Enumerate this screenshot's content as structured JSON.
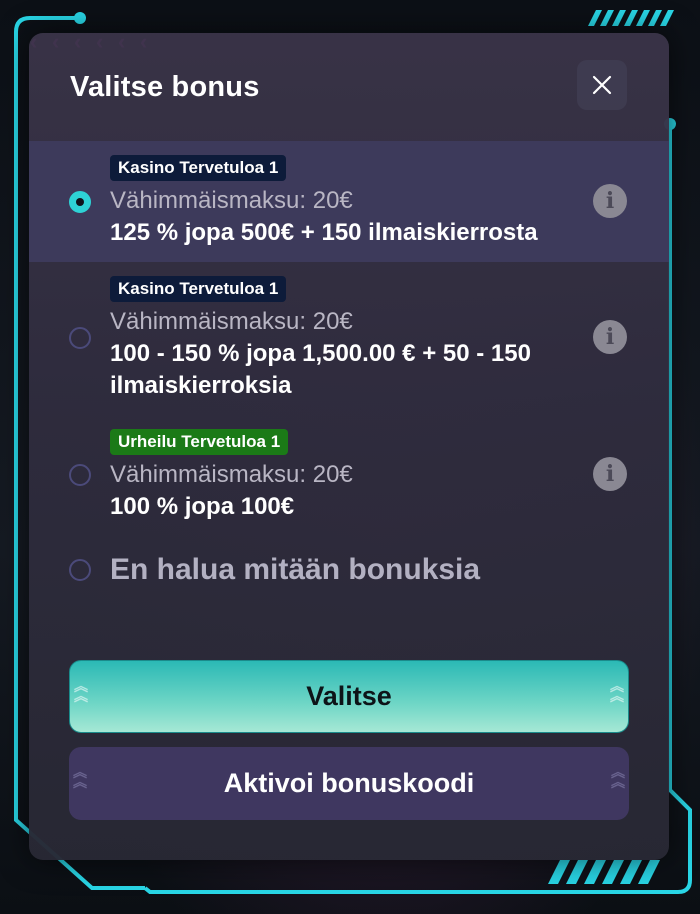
{
  "modal": {
    "title": "Valitse bonus",
    "close_icon": "close-icon"
  },
  "options": [
    {
      "badge": "Kasino Tervetuloa 1",
      "badge_color": "#0d1b3a",
      "min_payment": "Vähimmäismaksu: 20€",
      "offer": "125 % jopa 500€ + 150 ilmaiskierrosta",
      "selected": true,
      "info_icon": "info-icon"
    },
    {
      "badge": "Kasino Tervetuloa 1",
      "badge_color": "#0d1b3a",
      "min_payment": "Vähimmäismaksu: 20€",
      "offer": "100 - 150 % jopa 1,500.00 € + 50 - 150 ilmaiskierroksia",
      "selected": false,
      "info_icon": "info-icon"
    },
    {
      "badge": "Urheilu Tervetuloa 1",
      "badge_color": "#1b7a17",
      "min_payment": "Vähimmäismaksu: 20€",
      "offer": "100 % jopa 100€",
      "selected": false,
      "info_icon": "info-icon"
    }
  ],
  "no_bonus": {
    "label": "En halua mitään bonuksia",
    "selected": false
  },
  "buttons": {
    "primary_label": "Valitse",
    "secondary_label": "Aktivoi bonuskoodi"
  },
  "colors": {
    "accent": "#2ed3d6",
    "frame": "#29d6e6",
    "chevrons": "#d81bd8",
    "selected_row": "#3d3a5b"
  }
}
